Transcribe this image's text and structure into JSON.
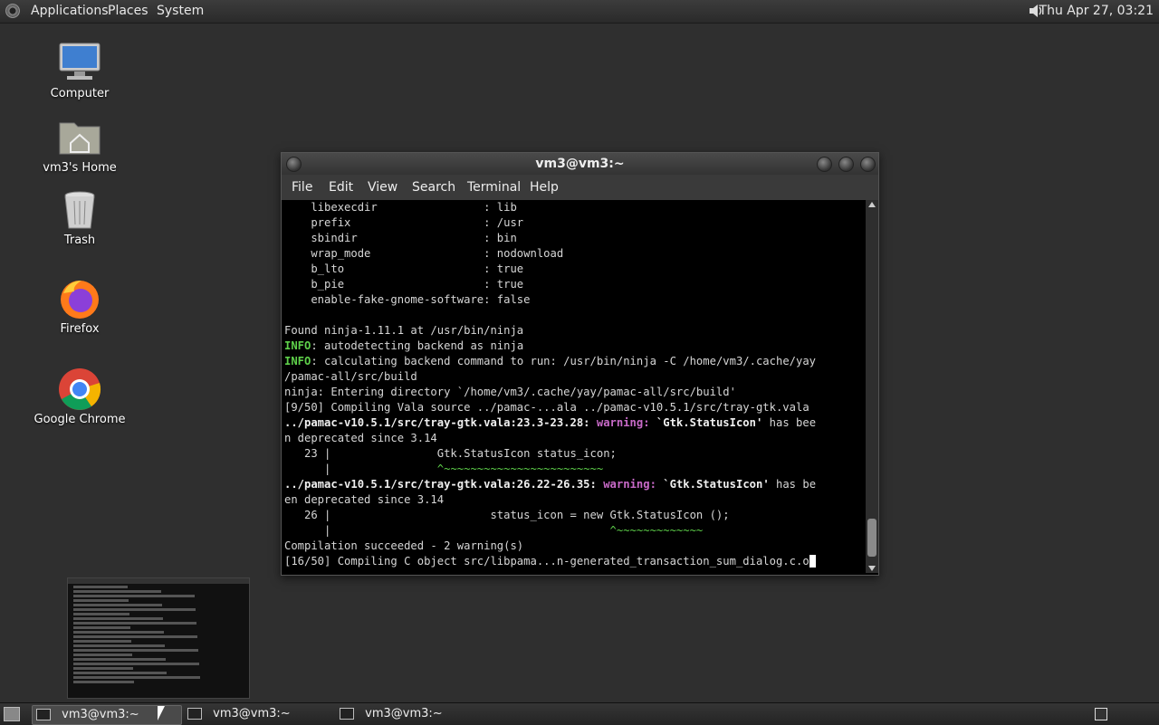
{
  "top_panel": {
    "applications": "Applications",
    "places": "Places",
    "system": "System",
    "clock": "Thu Apr 27, 03:21"
  },
  "desktop_icons": [
    {
      "label": "Computer",
      "icon": "computer-icon"
    },
    {
      "label": "vm3's Home",
      "icon": "home-folder-icon"
    },
    {
      "label": "Trash",
      "icon": "trash-icon"
    },
    {
      "label": "Firefox",
      "icon": "firefox-icon"
    },
    {
      "label": "Google Chrome",
      "icon": "chrome-icon"
    }
  ],
  "terminal": {
    "title": "vm3@vm3:~",
    "menu": [
      "File",
      "Edit",
      "View",
      "Search",
      "Terminal",
      "Help"
    ],
    "lines": [
      "    libexecdir                : lib",
      "    prefix                    : /usr",
      "    sbindir                   : bin",
      "    wrap_mode                 : nodownload",
      "    b_lto                     : true",
      "    b_pie                     : true",
      "    enable-fake-gnome-software: false",
      "",
      "Found ninja-1.11.1 at /usr/bin/ninja",
      "INFO: autodetecting backend as ninja",
      "INFO: calculating backend command to run: /usr/bin/ninja -C /home/vm3/.cache/yay",
      "/pamac-all/src/build",
      "ninja: Entering directory `/home/vm3/.cache/yay/pamac-all/src/build'",
      "[9/50] Compiling Vala source ../pamac-...ala ../pamac-v10.5.1/src/tray-gtk.vala",
      "../pamac-v10.5.1/src/tray-gtk.vala:23.3-23.28: warning: `Gtk.StatusIcon' has bee",
      "n deprecated since 3.14",
      "   23 |                Gtk.StatusIcon status_icon;",
      "      |                ^~~~~~~~~~~~~~~~~~~~~~~~~",
      "../pamac-v10.5.1/src/tray-gtk.vala:26.22-26.35: warning: `Gtk.StatusIcon' has be",
      "en deprecated since 3.14",
      "   26 |                        status_icon = new Gtk.StatusIcon ();",
      "      |                                          ^~~~~~~~~~~~~~",
      "Compilation succeeded - 2 warning(s)",
      "[16/50] Compiling C object src/libpama...n-generated_transaction_sum_dialog.c.o"
    ]
  },
  "taskbar": {
    "tasks": [
      "vm3@vm3:~",
      "vm3@vm3:~",
      "vm3@vm3:~"
    ]
  }
}
